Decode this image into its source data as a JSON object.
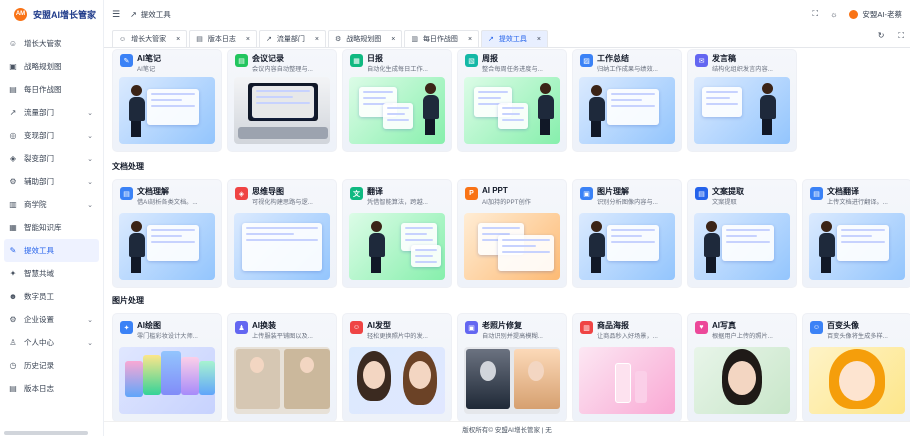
{
  "app": {
    "logo_badge": "AM",
    "name": "安盟AI增长管家"
  },
  "sidebar": {
    "items": [
      {
        "icon": "user-icon",
        "glyph": "☺",
        "label": "增长大管家",
        "chevron": false
      },
      {
        "icon": "strategy-icon",
        "glyph": "▣",
        "label": "战略规划图",
        "chevron": false
      },
      {
        "icon": "chart-icon",
        "glyph": "▤",
        "label": "每日作战图",
        "chevron": false
      },
      {
        "icon": "trend-icon",
        "glyph": "↗",
        "label": "流量部门",
        "chevron": true
      },
      {
        "icon": "transform-icon",
        "glyph": "◎",
        "label": "变现部门",
        "chevron": true
      },
      {
        "icon": "split-icon",
        "glyph": "◈",
        "label": "裂变部门",
        "chevron": true
      },
      {
        "icon": "assist-icon",
        "glyph": "⚙",
        "label": "辅助部门",
        "chevron": true
      },
      {
        "icon": "school-icon",
        "glyph": "▥",
        "label": "商学院",
        "chevron": true
      },
      {
        "icon": "knowledge-icon",
        "glyph": "▦",
        "label": "智能知识库",
        "chevron": false
      },
      {
        "icon": "tool-icon",
        "glyph": "✎",
        "label": "提效工具",
        "chevron": false,
        "active": true
      },
      {
        "icon": "consensus-icon",
        "glyph": "✦",
        "label": "智慧共域",
        "chevron": false
      },
      {
        "icon": "digital-staff-icon",
        "glyph": "☻",
        "label": "数字员工",
        "chevron": false
      },
      {
        "icon": "enterprise-icon",
        "glyph": "⚙",
        "label": "企业设置",
        "chevron": true
      },
      {
        "icon": "personal-icon",
        "glyph": "♙",
        "label": "个人中心",
        "chevron": true
      },
      {
        "icon": "history-icon",
        "glyph": "◷",
        "label": "历史记录",
        "chevron": false
      },
      {
        "icon": "version-icon",
        "glyph": "▤",
        "label": "版本日志",
        "chevron": false
      }
    ]
  },
  "header": {
    "menu_glyph": "☰",
    "breadcrumb": "提效工具",
    "breadcrumb_glyph": "↗",
    "fullscreen_glyph": "⛶",
    "theme_glyph": "☼",
    "user_name": "安盟AI-老蔡"
  },
  "tabs": [
    {
      "glyph": "☺",
      "label": "增长大管家",
      "close": "×"
    },
    {
      "glyph": "▤",
      "label": "版本日志",
      "close": "×"
    },
    {
      "glyph": "↗",
      "label": "流量部门",
      "close": "×"
    },
    {
      "glyph": "⚙",
      "label": "战略规划图",
      "close": "×"
    },
    {
      "glyph": "▥",
      "label": "每日作战图",
      "close": "×"
    },
    {
      "glyph": "↗",
      "label": "提效工具",
      "close": "×",
      "active": true
    }
  ],
  "tab_tools": {
    "refresh": "↻",
    "expand": "⛶"
  },
  "sections": [
    {
      "title": "",
      "cards": [
        {
          "title": "AI笔记",
          "desc": "AI笔记",
          "color": "#3b82f6",
          "glyph": "✎",
          "art": "note"
        },
        {
          "title": "会议记录",
          "desc": "会议内容自动整理与...",
          "color": "#22c55e",
          "glyph": "▤",
          "art": "meeting"
        },
        {
          "title": "日报",
          "desc": "自动化生成每日工作...",
          "color": "#10b981",
          "glyph": "▦",
          "art": "daily"
        },
        {
          "title": "周报",
          "desc": "整合每周任务进度与...",
          "color": "#14b8a6",
          "glyph": "▧",
          "art": "weekly"
        },
        {
          "title": "工作总结",
          "desc": "归纳工作成果与绩效...",
          "color": "#3b82f6",
          "glyph": "▨",
          "art": "summary"
        },
        {
          "title": "发言稿",
          "desc": "结构化组织发言内容...",
          "color": "#6366f1",
          "glyph": "✉",
          "art": "speech"
        }
      ]
    },
    {
      "title": "文档处理",
      "cards": [
        {
          "title": "文档理解",
          "desc": "借AI剖析各类文档。...",
          "color": "#3b82f6",
          "glyph": "▤",
          "art": "doc"
        },
        {
          "title": "思维导图",
          "desc": "可视化构建思路与逻...",
          "color": "#ef4444",
          "glyph": "◈",
          "art": "mind"
        },
        {
          "title": "翻译",
          "desc": "凭借智能算法，跨越...",
          "color": "#10b981",
          "glyph": "文",
          "art": "translate"
        },
        {
          "title": "AI PPT",
          "desc": "AI加持的PPT创作",
          "color": "#f97316",
          "glyph": "P",
          "art": "ppt"
        },
        {
          "title": "图片理解",
          "desc": "识别分析图像内容与...",
          "color": "#3b82f6",
          "glyph": "▣",
          "art": "imgunderstand"
        },
        {
          "title": "文案提取",
          "desc": "文案提取",
          "color": "#2563eb",
          "glyph": "▤",
          "art": "extract"
        },
        {
          "title": "文档翻译",
          "desc": "上传文档进行翻译。...",
          "color": "#3b82f6",
          "glyph": "▤",
          "art": "doctrans"
        }
      ]
    },
    {
      "title": "图片处理",
      "cards": [
        {
          "title": "AI绘图",
          "desc": "零门槛彩妆设计大师...",
          "color": "#3b82f6",
          "glyph": "✦",
          "art": "draw"
        },
        {
          "title": "AI换装",
          "desc": "上传服装平铺图以及...",
          "color": "#6366f1",
          "glyph": "♟",
          "art": "outfit"
        },
        {
          "title": "AI发型",
          "desc": "轻松更换照片中的发...",
          "color": "#ef4444",
          "glyph": "☺",
          "art": "hair"
        },
        {
          "title": "老照片修复",
          "desc": "自动识别并提高模糊...",
          "color": "#6366f1",
          "glyph": "▣",
          "art": "restore"
        },
        {
          "title": "商品海报",
          "desc": "让商品秒入好场景，...",
          "color": "#ef4444",
          "glyph": "▥",
          "art": "poster"
        },
        {
          "title": "AI写真",
          "desc": "根据用户上传的照片...",
          "color": "#ec4899",
          "glyph": "♥",
          "art": "portrait"
        },
        {
          "title": "百变头像",
          "desc": "百变头像将生成多样...",
          "color": "#3b82f6",
          "glyph": "☺",
          "art": "avatar"
        }
      ]
    }
  ],
  "footer": "版权所有© 安盟AI增长管家 | 无"
}
